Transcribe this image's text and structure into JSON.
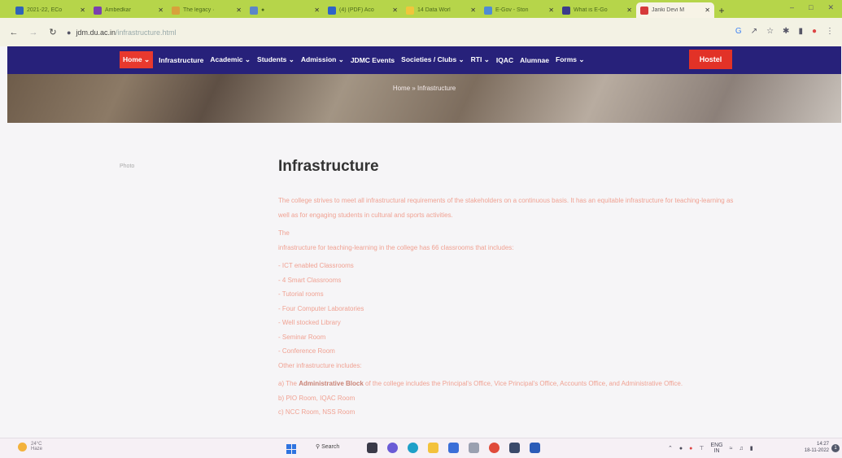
{
  "browser": {
    "tabs": [
      {
        "title": "2021-22, ECo",
        "color": "#2f63b8"
      },
      {
        "title": "Ambedkar",
        "color": "#7a3fb0"
      },
      {
        "title": "The legacy ·",
        "color": "#d8a13b"
      },
      {
        "title": "●",
        "color": "#5b86c8"
      },
      {
        "title": "(4) (PDF) Aco",
        "color": "#2e63c7"
      },
      {
        "title": "14 Data Worl",
        "color": "#f0c63c"
      },
      {
        "title": "E-Gov - Ston",
        "color": "#4f8bd6"
      },
      {
        "title": "What is E-Go",
        "color": "#3b3b8c"
      },
      {
        "title": "Janki Devi M",
        "color": "#d63a3a"
      }
    ],
    "active_tab": 8,
    "new_tab": "+",
    "url_domain": "jdm.du.ac.in",
    "url_path": "/infrastructure.html"
  },
  "site": {
    "nav": [
      "Home",
      "Infrastructure",
      "Academic",
      "Students",
      "Admission",
      "JDMC Events",
      "Societies / Clubs",
      "RTI",
      "IQAC",
      "Alumnae",
      "Forms"
    ],
    "hostel": "Hostel",
    "breadcrumb": "Home » Infrastructure"
  },
  "page": {
    "sidebar_label": "Photo",
    "title": "Infrastructure",
    "intro": "The college strives to meet all infrastructural requirements of the stakeholders on a continuous basis. It has an equitable infrastructure for teaching-learning as well as for engaging students in cultural and sports activities.",
    "the_word": "The",
    "lead": "infrastructure for teaching-learning in the college has 66 classrooms that includes:",
    "items": [
      "ICT enabled Classrooms",
      "4 Smart Classrooms",
      "Tutorial rooms",
      "Four Computer Laboratories",
      "Well stocked Library",
      "Seminar Room",
      "Conference Room"
    ],
    "other": "Other infrastructure includes:",
    "a_prefix": "a) The ",
    "a_bold": "Administrative Block",
    "a_rest": " of the college includes the Principal's Office, Vice Principal's Office, Accounts Office, and Administrative Office.",
    "b": "b) PIO Room, IQAC Room",
    "c": "c) NCC Room, NSS Room"
  },
  "taskbar": {
    "weather_temp": "24°C",
    "weather_desc": "Haze",
    "search": "Search",
    "lang": "ENG",
    "region": "IN",
    "time": "14:27",
    "date": "18-11-2022",
    "notifications": "1"
  }
}
